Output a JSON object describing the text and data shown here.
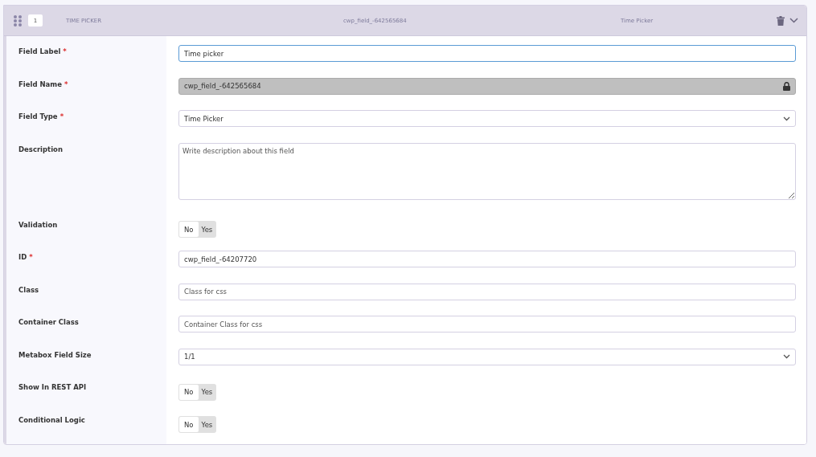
{
  "header": {
    "index": "1",
    "title": "TIME PICKER",
    "field_name": "cwp_field_-642565684",
    "field_type": "Time Picker"
  },
  "rows": [
    {
      "label": "Field Label",
      "required_mark": "*",
      "kind": "text",
      "value": "Time picker",
      "focused": true
    },
    {
      "label": "Field Name",
      "required_mark": "*",
      "kind": "locked",
      "value": "cwp_field_-642565684"
    },
    {
      "label": "Field Type",
      "required_mark": "*",
      "kind": "select",
      "value": "Time Picker"
    },
    {
      "label": "Description",
      "kind": "textarea",
      "placeholder": "Write description about this field"
    },
    {
      "label": "Validation",
      "kind": "toggle",
      "options": [
        {
          "label": "No",
          "selected": true
        },
        {
          "label": "Yes",
          "selected": false
        }
      ]
    },
    {
      "label": "ID",
      "required_mark": "*",
      "kind": "text",
      "value": "cwp_field_-64207720",
      "focused": false
    },
    {
      "label": "Class",
      "kind": "text",
      "placeholder": "Class for css",
      "focused": false
    },
    {
      "label": "Container Class",
      "kind": "text",
      "placeholder": "Container Class for css",
      "focused": false
    },
    {
      "label": "Metabox Field Size",
      "kind": "select",
      "value": "1/1"
    },
    {
      "label": "Show In REST API",
      "kind": "toggle",
      "options": [
        {
          "label": "No",
          "selected": true
        },
        {
          "label": "Yes",
          "selected": false
        }
      ]
    },
    {
      "label": "Conditional Logic",
      "kind": "toggle",
      "options": [
        {
          "label": "No",
          "selected": true
        },
        {
          "label": "Yes",
          "selected": false
        }
      ]
    }
  ]
}
